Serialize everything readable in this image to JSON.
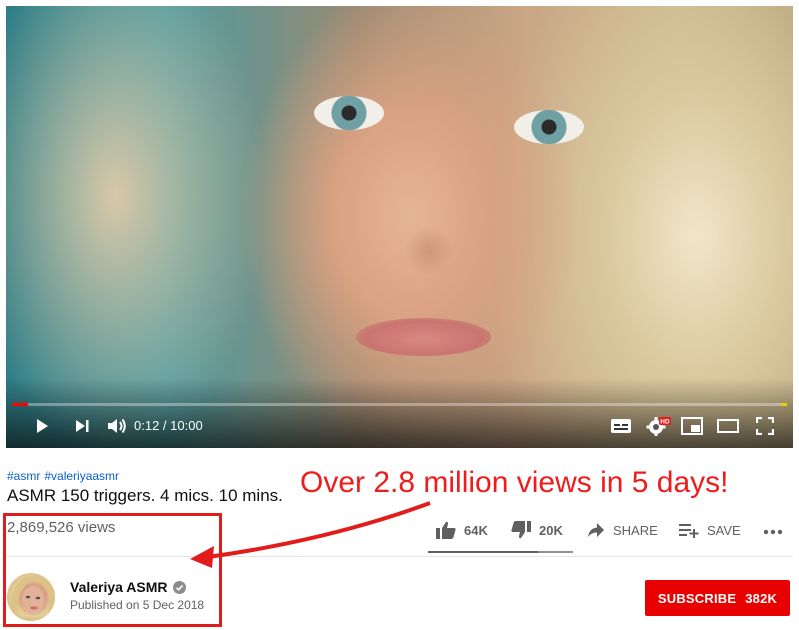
{
  "player": {
    "current_time": "0:12",
    "duration": "10:00",
    "time_display": "0:12 / 10:00",
    "progress_fraction": 0.02,
    "colors": {
      "progress": "#ff0000",
      "ad_marker": "#f6c900"
    }
  },
  "video": {
    "hashtags": [
      "#asmr",
      "#valeriyaasmr"
    ],
    "title": "ASMR 150 triggers. 4 mics. 10 mins.",
    "views": "2,869,526 views"
  },
  "actions": {
    "likes": "64K",
    "dislikes": "20K",
    "share_label": "SHARE",
    "save_label": "SAVE",
    "like_fraction": 0.76
  },
  "channel": {
    "name": "Valeriya ASMR",
    "published": "Published on 5 Dec 2018",
    "subscribe_label": "SUBSCRIBE",
    "subscriber_count": "382K",
    "colors": {
      "subscribe": "#e90000"
    }
  },
  "annotation": {
    "text": "Over 2.8 million views in 5 days!",
    "color": "#ee1c1c"
  },
  "icons": {
    "play": "play-icon",
    "next": "next-icon",
    "volume": "volume-icon",
    "subtitles": "subtitles-icon",
    "settings": "settings-hd-icon",
    "miniplayer": "miniplayer-icon",
    "theater": "theater-icon",
    "fullscreen": "fullscreen-icon",
    "like": "thumbs-up-icon",
    "dislike": "thumbs-down-icon",
    "share": "share-icon",
    "save": "playlist-add-icon",
    "more": "more-icon",
    "verified": "verified-check-icon"
  }
}
